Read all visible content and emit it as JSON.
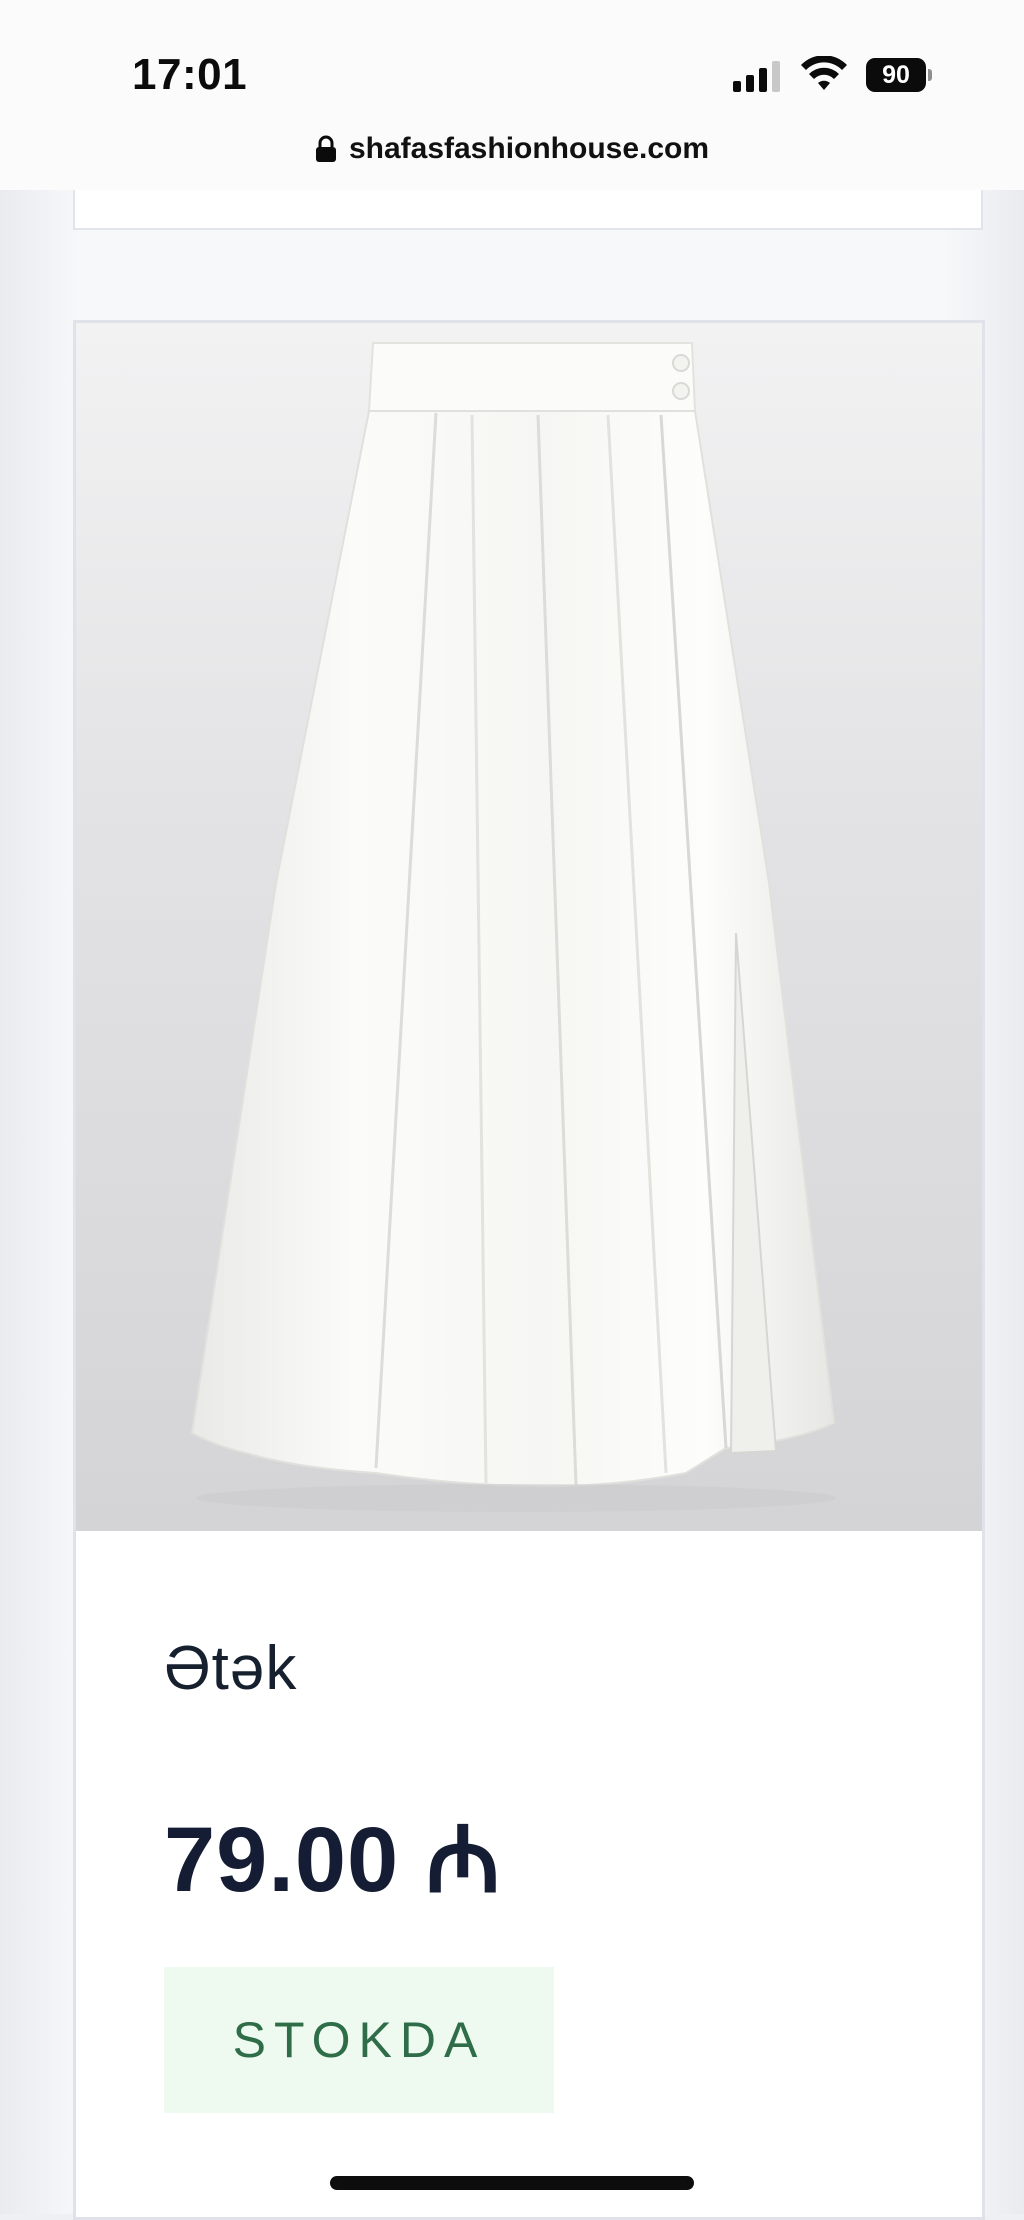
{
  "status_bar": {
    "time": "17:01",
    "battery_level": "90",
    "signal_icon": "signal-bars-icon",
    "wifi_icon": "wifi-icon"
  },
  "browser": {
    "url": "shafasfashionhouse.com",
    "lock_icon": "lock-icon"
  },
  "product": {
    "title": "Ətək",
    "price": "79.00 ₼",
    "stock_status": "STOKDA",
    "image_icon": "skirt-image",
    "colors": {
      "price_text": "#141d33",
      "stock_text": "#2f6d49",
      "stock_bg": "#eefaf0"
    }
  }
}
